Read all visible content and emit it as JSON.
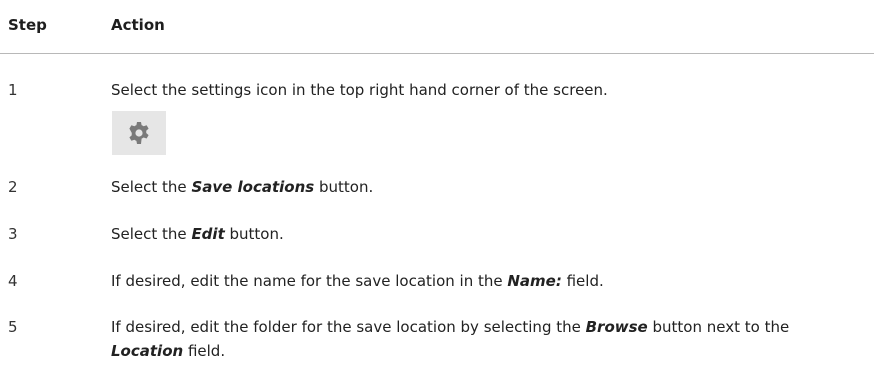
{
  "table": {
    "headers": {
      "step": "Step",
      "action": "Action"
    },
    "rows": [
      {
        "step": "1",
        "parts": [
          "Select the settings icon in the top right hand corner of the screen."
        ],
        "icon": "gear-icon"
      },
      {
        "step": "2",
        "parts": [
          "Select the ",
          "Save locations",
          " button."
        ]
      },
      {
        "step": "3",
        "parts": [
          "Select the ",
          "Edit",
          " button."
        ]
      },
      {
        "step": "4",
        "parts": [
          "If desired, edit the name for the save location in the ",
          "Name:",
          " field."
        ]
      },
      {
        "step": "5",
        "parts": [
          "If desired, edit the folder for the save location by selecting the ",
          "Browse",
          " button next to the ",
          "Location",
          " field."
        ]
      }
    ]
  },
  "colors": {
    "icon_bg": "#e6e6e6",
    "icon_fg": "#7a7a7a",
    "rule": "#b8b8b8"
  }
}
